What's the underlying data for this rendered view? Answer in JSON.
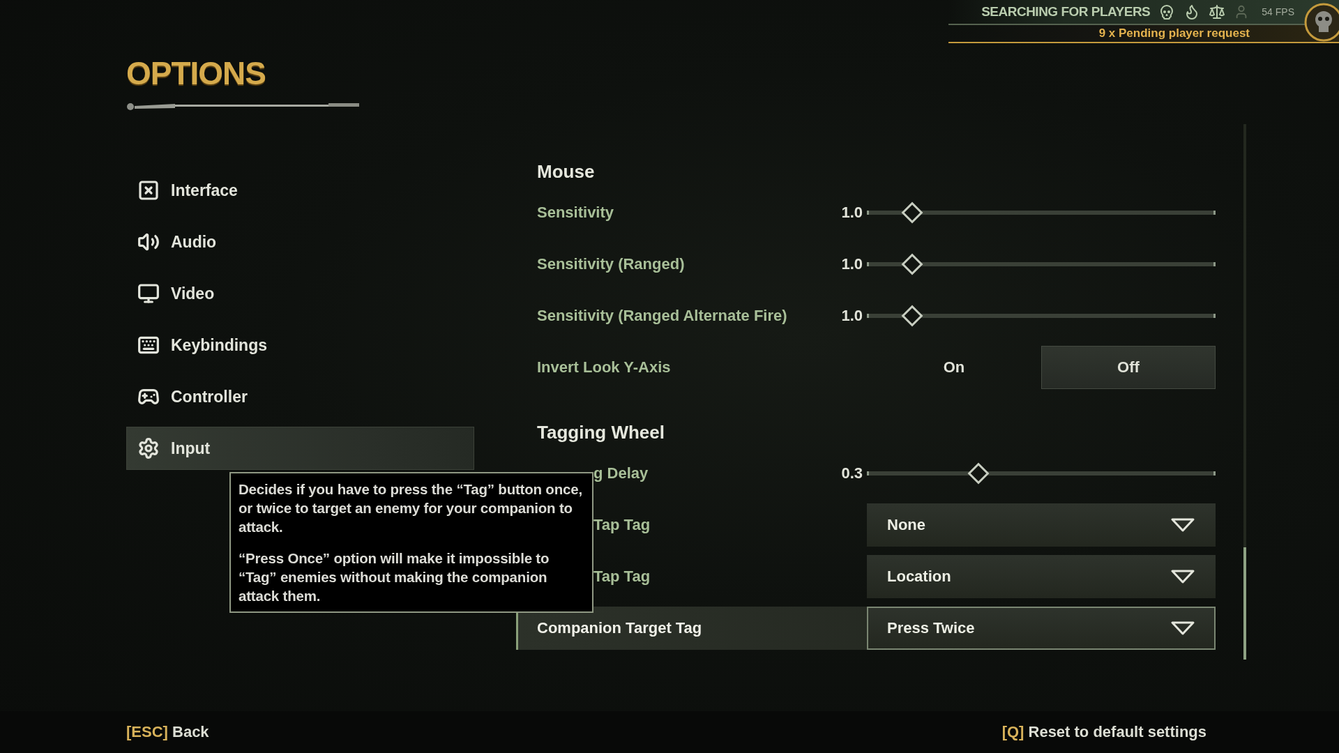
{
  "header": {
    "title": "OPTIONS"
  },
  "status": {
    "text": "SEARCHING FOR PLAYERS",
    "fps": "54 FPS",
    "notice": "9 x Pending player request"
  },
  "sidebar": {
    "items": [
      {
        "label": "Interface",
        "selected": false
      },
      {
        "label": "Audio",
        "selected": false
      },
      {
        "label": "Video",
        "selected": false
      },
      {
        "label": "Keybindings",
        "selected": false
      },
      {
        "label": "Controller",
        "selected": false
      },
      {
        "label": "Input",
        "selected": true
      }
    ]
  },
  "sections": [
    {
      "title": "Mouse",
      "rows": [
        {
          "kind": "slider",
          "label": "Sensitivity",
          "reading": "1.0",
          "level": 0.13,
          "selected": false,
          "obscured": false
        },
        {
          "kind": "slider",
          "label": "Sensitivity (Ranged)",
          "reading": "1.0",
          "level": 0.13,
          "selected": false,
          "obscured": false
        },
        {
          "kind": "slider",
          "label": "Sensitivity (Ranged Alternate Fire)",
          "reading": "1.0",
          "level": 0.13,
          "selected": false,
          "obscured": false
        },
        {
          "kind": "toggle",
          "label": "Invert Look Y-Axis",
          "options": [
            {
              "label": "On",
              "selected": false
            },
            {
              "label": "Off",
              "selected": true
            }
          ],
          "selected": false,
          "obscured": false
        }
      ]
    },
    {
      "title": "Tagging Wheel",
      "rows": [
        {
          "kind": "slider",
          "label": "g Delay",
          "reading": "0.3",
          "level": 0.32,
          "selected": false,
          "obscured": true
        },
        {
          "kind": "dropdown",
          "label": "Tap Tag",
          "value": "None",
          "selected": false,
          "obscured": true
        },
        {
          "kind": "dropdown",
          "label": "Tap Tag",
          "value": "Location",
          "selected": false,
          "obscured": true
        },
        {
          "kind": "dropdown",
          "label": "Companion Target Tag",
          "value": "Press Twice",
          "selected": true,
          "obscured": false
        }
      ]
    }
  ],
  "tooltip": {
    "paragraphs": [
      "Decides if you have to press the “Tag” button once, or twice to target an enemy for your companion to attack.",
      "“Press Once” option will make it impossible to “Tag” enemies without making the companion attack them."
    ]
  },
  "footer": {
    "back": {
      "key": "[ESC]",
      "label": "Back"
    },
    "reset": {
      "key": "[Q]",
      "label": "Reset to default settings"
    }
  }
}
